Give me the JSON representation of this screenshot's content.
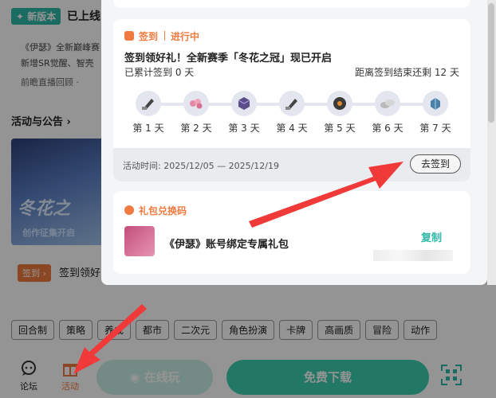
{
  "background": {
    "new_badge": "✦ 新版本",
    "title": "已上线",
    "desc": "《伊瑟》全新巅峰赛 新增SR觉醒、智壳",
    "live": "前瞻直播回顾 ·",
    "section_title": "活动与公告 ›",
    "banner_line1": "冬花之",
    "banner_line2": "创作征集开启",
    "sign_tag": "签到 ›",
    "sign_text": "签到领好",
    "tags": [
      "回合制",
      "策略",
      "养成",
      "都市",
      "二次元",
      "角色扮演",
      "卡牌",
      "高画质",
      "冒险",
      "动作"
    ]
  },
  "bottom_nav": {
    "forum": "论坛",
    "activity": "活动",
    "play_online": "在线玩",
    "download": "免费下载"
  },
  "sign_card": {
    "header_label": "签到",
    "status": "进行中",
    "title": "签到领好礼！全新赛季「冬花之冠」现已开启",
    "count": "已累计签到 0 天",
    "remain": "距离签到结束还剩 12 天",
    "days": [
      {
        "label": "第 1 天",
        "icon": "sword-icon"
      },
      {
        "label": "第 2 天",
        "icon": "candy-icon"
      },
      {
        "label": "第 3 天",
        "icon": "cube-icon"
      },
      {
        "label": "第 4 天",
        "icon": "sword-icon"
      },
      {
        "label": "第 5 天",
        "icon": "disc-icon"
      },
      {
        "label": "第 6 天",
        "icon": "coins-icon"
      },
      {
        "label": "第 7 天",
        "icon": "gem-icon"
      }
    ],
    "period": "活动时间: 2025/12/05 — 2025/12/19",
    "button": "去签到"
  },
  "gift_card": {
    "header_label": "礼包兑换码",
    "gift_name": "《伊瑟》账号绑定专属礼包",
    "copy": "复制"
  },
  "colors": {
    "accent_orange": "#f07a3f",
    "accent_teal": "#2eb8a8",
    "arrow_red": "#f03a3a"
  }
}
